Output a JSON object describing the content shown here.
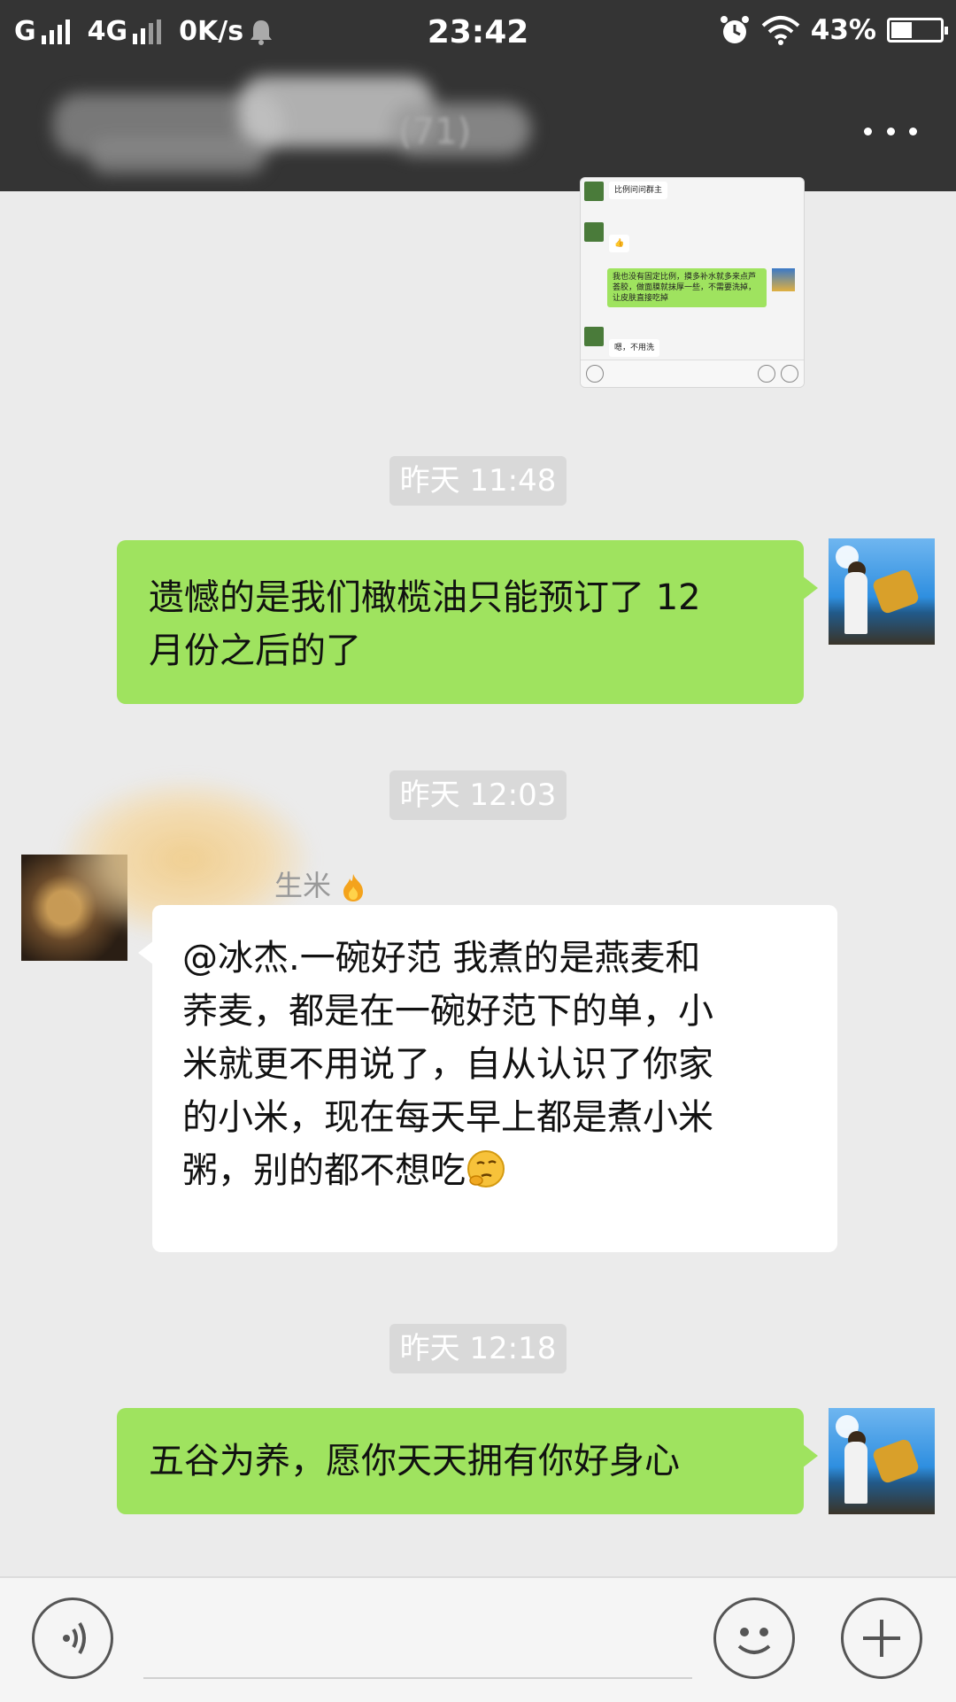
{
  "status_bar": {
    "network_1": "G",
    "network_2": "4G",
    "speed": "0K/s",
    "time": "23:42",
    "battery": "43%",
    "battery_level": 0.43
  },
  "titlebar": {
    "title": "(71)",
    "more_icon": "more-dots-icon"
  },
  "shared_screenshot": {
    "messages": [
      {
        "side": "in",
        "text": "比例问问群主"
      },
      {
        "side": "in",
        "text": "👍"
      },
      {
        "side": "out",
        "text": "我也没有固定比例，摸多补水就多来点芦荟胶，做面膜就抹厚一些，不需要洗掉，让皮肤直接吃掉"
      },
      {
        "side": "in",
        "text": "嗯，不用洗"
      }
    ]
  },
  "chat": {
    "timestamps": [
      "昨天 11:48",
      "昨天 12:03",
      "昨天 12:18"
    ],
    "msg1": {
      "line1": "遗憾的是我们橄榄油只能预订了 12",
      "line2": "月份之后的了"
    },
    "incoming": {
      "sender": "生米",
      "lines": [
        "@冰杰.一碗好范  我煮的是燕麦和",
        "荞麦，都是在一碗好范下的单，小",
        "米就更不用说了，自从认识了你家",
        "的小米，现在每天早上都是煮小米",
        "粥，别的都不想吃"
      ],
      "emoji": "thinking-emoji"
    },
    "msg3": "五谷为养，愿你天天拥有你好身心"
  },
  "input_bar": {
    "voice_icon": "voice-icon",
    "emoji_icon": "emoji-icon",
    "plus_icon": "plus-icon"
  }
}
